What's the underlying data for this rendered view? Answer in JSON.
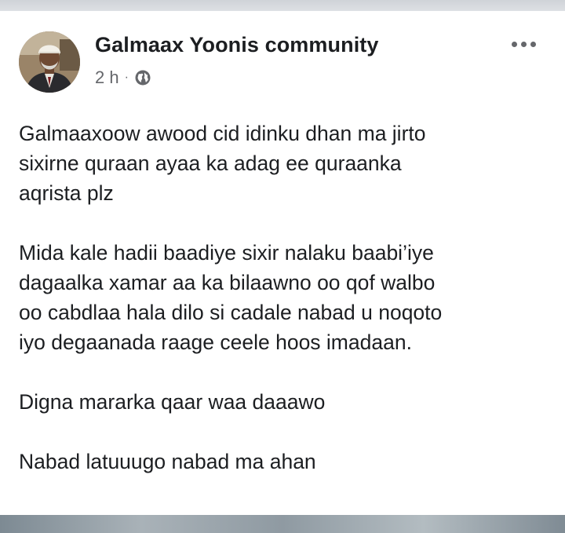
{
  "post": {
    "author": "Galmaax Yoonis community",
    "time": "2 h",
    "separator": "·",
    "audience_icon": "globe-icon",
    "more_icon": "more-options-icon",
    "paragraphs": [
      [
        "Galmaaxoow awood cid idinku dhan ma jirto",
        "sixirne quraan ayaa ka adag ee quraanka",
        "aqrista plz"
      ],
      [
        "Mida kale hadii baadiye sixir nalaku baabi’iye",
        "dagaalka xamar aa ka bilaawno oo qof walbo",
        "oo cabdlaa hala dilo si cadale nabad u noqoto",
        "iyo degaanada raage ceele hoos imadaan."
      ],
      [
        "Digna mararka qaar waa daaawo"
      ],
      [
        "Nabad latuuugo nabad ma ahan"
      ]
    ]
  },
  "colors": {
    "text": "#1c1e21",
    "secondary_text": "#65676b",
    "background": "#ffffff"
  }
}
